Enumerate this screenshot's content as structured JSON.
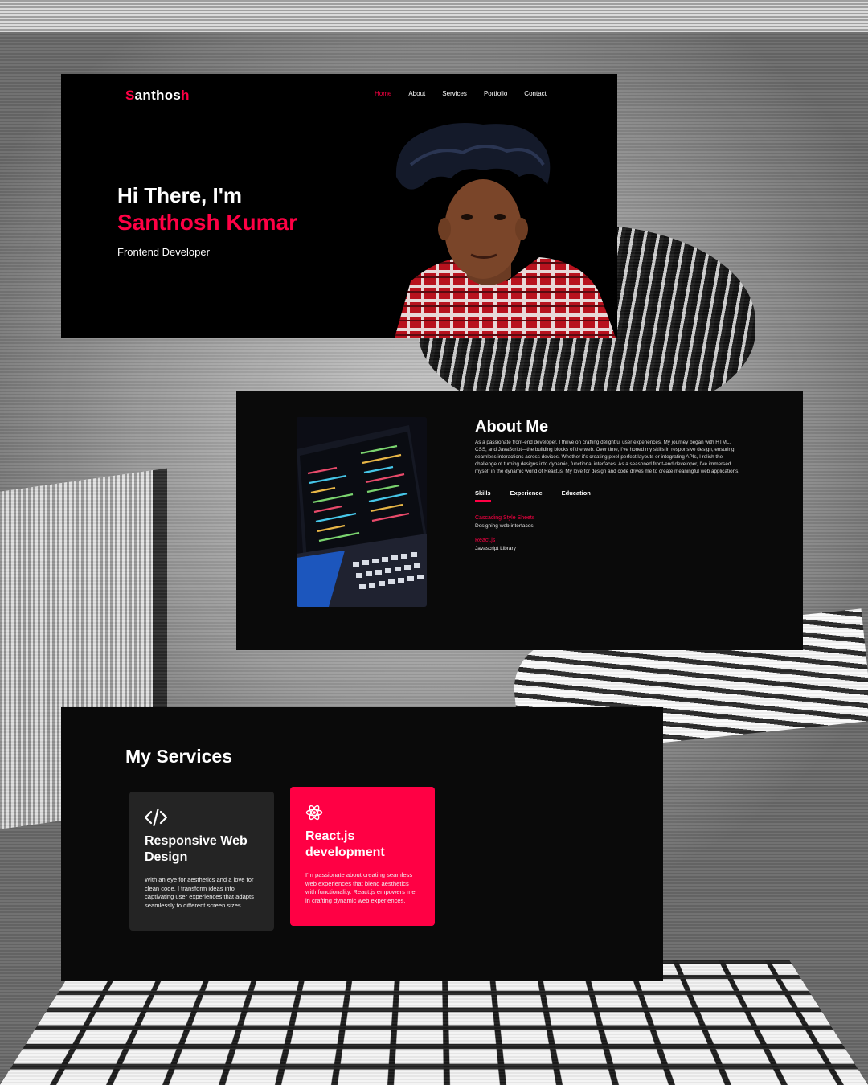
{
  "colors": {
    "accent": "#ff0044",
    "panel_bg": "#000000",
    "card_bg": "#242424"
  },
  "hero": {
    "logo_main": "Santhos",
    "logo_accent_first": "S",
    "logo_accent_last": "h",
    "logo_middle": "anthos",
    "nav": [
      "Home",
      "About",
      "Services",
      "Portfolio",
      "Contact"
    ],
    "nav_active": "Home",
    "greeting": "Hi There, I'm",
    "name": "Santhosh Kumar",
    "role": "Frontend Developer"
  },
  "about": {
    "title": "About Me",
    "body": "As a passionate front-end developer, I thrive on crafting delightful user experiences. My journey began with HTML, CSS, and JavaScript—the building blocks of the web. Over time, I've honed my skills in responsive design, ensuring seamless interactions across devices. Whether it's creating pixel-perfect layouts or integrating APIs, I relish the challenge of turning designs into dynamic, functional interfaces. As a seasoned front-end developer, I've immersed myself in the dynamic world of React.js. My love for design and code drives me to create meaningful web applications.",
    "tabs": [
      "Skills",
      "Experience",
      "Education"
    ],
    "skills": [
      {
        "name": "Cascading Style Sheets",
        "desc": "Designing web interfaces"
      },
      {
        "name": "React.js",
        "desc": "Javascript Library"
      }
    ]
  },
  "services": {
    "title": "My Services",
    "cards": [
      {
        "icon": "code-icon",
        "title": "Responsive Web Design",
        "text": "With an eye for aesthetics and a love for clean code, I transform ideas into captivating user experiences that adapts seamlessly to different screen sizes."
      },
      {
        "icon": "react-icon",
        "title": "React.js development",
        "text": "I'm passionate about creating seamless web experiences that blend aesthetics with functionality. React.js empowers me in crafting dynamic web experiences."
      }
    ]
  }
}
